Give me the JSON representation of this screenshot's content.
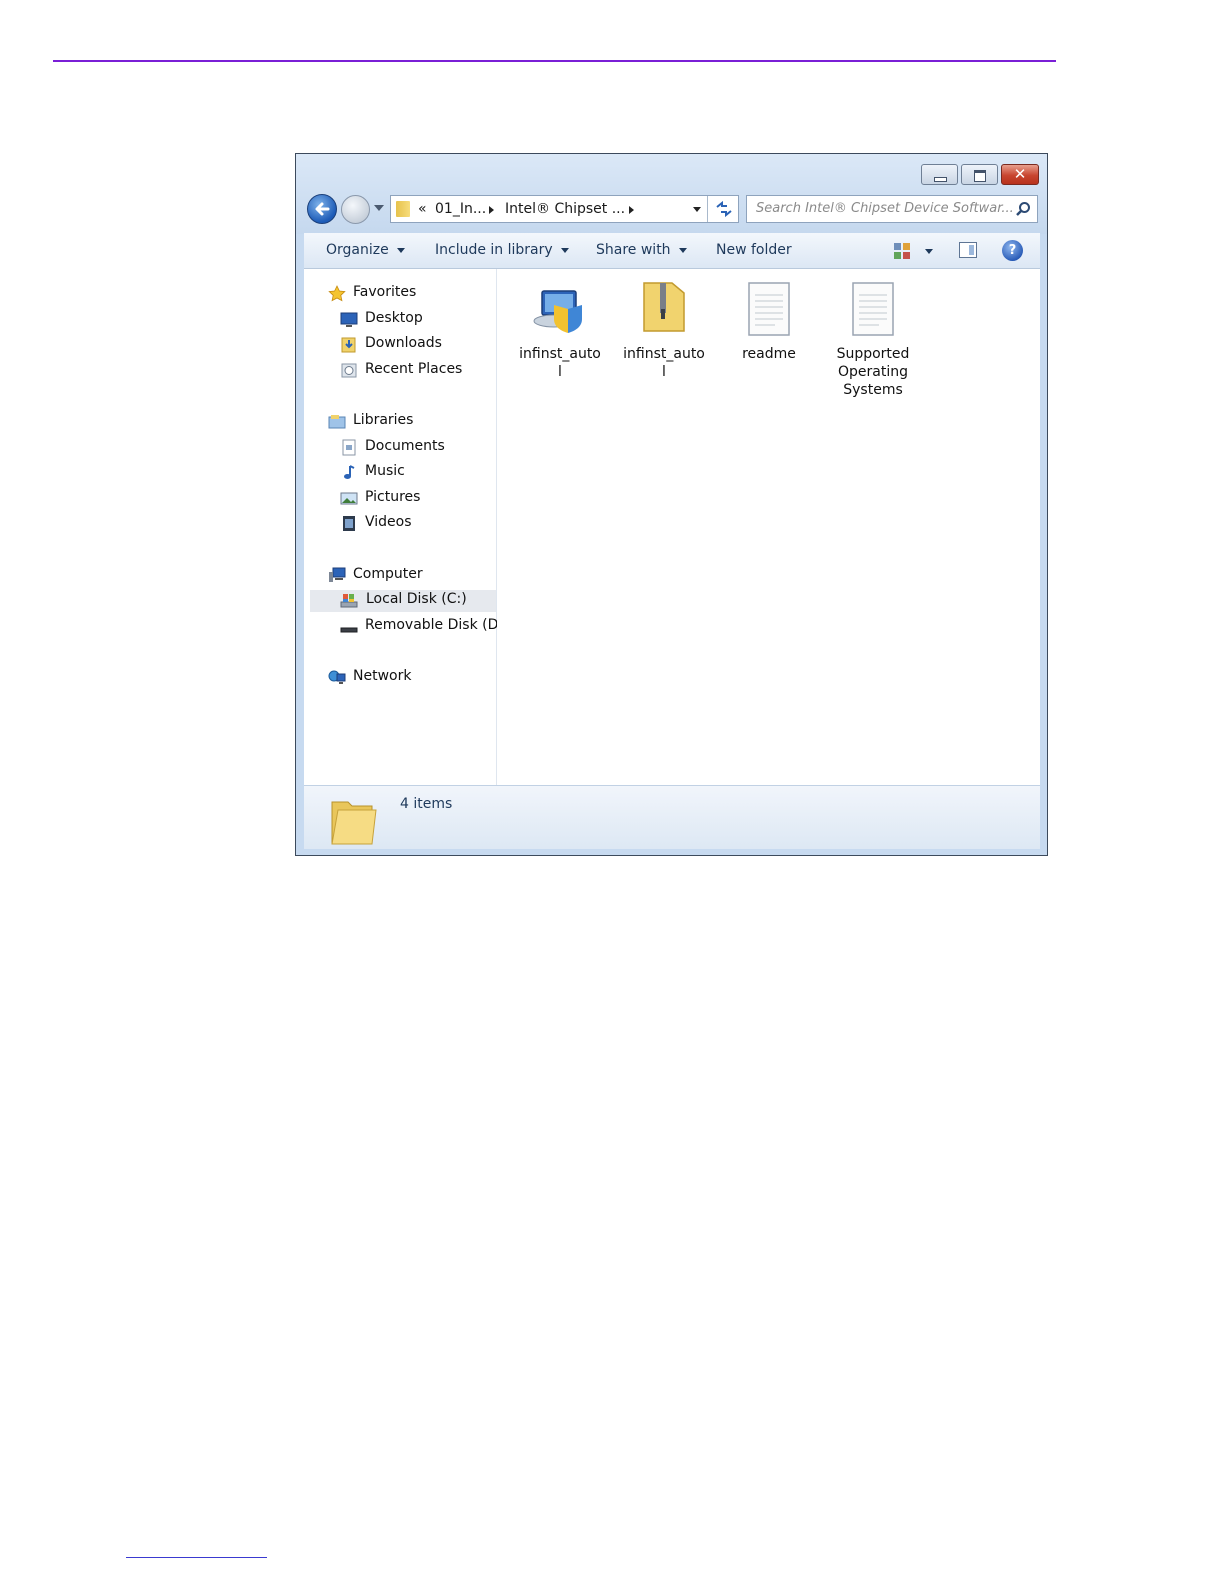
{
  "window": {
    "controls": {
      "minimize": "minimize",
      "maximize": "maximize",
      "close": "✕"
    }
  },
  "address_bar": {
    "overflow": "«",
    "segment_1": "01_In...",
    "segment_2": "Intel® Chipset ...",
    "refresh_icon": "refresh-icon"
  },
  "search": {
    "placeholder": "Search Intel® Chipset Device Softwar..."
  },
  "toolbar": {
    "organize": "Organize",
    "include_in_library": "Include in library",
    "share_with": "Share with",
    "new_folder": "New folder",
    "help": "?"
  },
  "nav_pane": {
    "favorites": {
      "label": "Favorites",
      "items": [
        "Desktop",
        "Downloads",
        "Recent Places"
      ]
    },
    "libraries": {
      "label": "Libraries",
      "items": [
        "Documents",
        "Music",
        "Pictures",
        "Videos"
      ]
    },
    "computer": {
      "label": "Computer",
      "items": [
        "Local Disk (C:)",
        "Removable Disk (D:)"
      ],
      "selected": "Local Disk (C:)"
    },
    "network": {
      "label": "Network"
    }
  },
  "files": [
    {
      "name": "infinst_auto\nl",
      "icon": "installer-shield-icon"
    },
    {
      "name": "infinst_auto\nl",
      "icon": "zip-folder-icon"
    },
    {
      "name": "readme",
      "icon": "text-document-icon"
    },
    {
      "name": "Supported\nOperating\nSystems",
      "icon": "text-document-icon"
    }
  ],
  "status_bar": {
    "text": "4 items"
  },
  "colors": {
    "top_rule": "#7a1fd6",
    "window_frame": "#c7daf0",
    "toolbar_text": "#1e395b"
  }
}
